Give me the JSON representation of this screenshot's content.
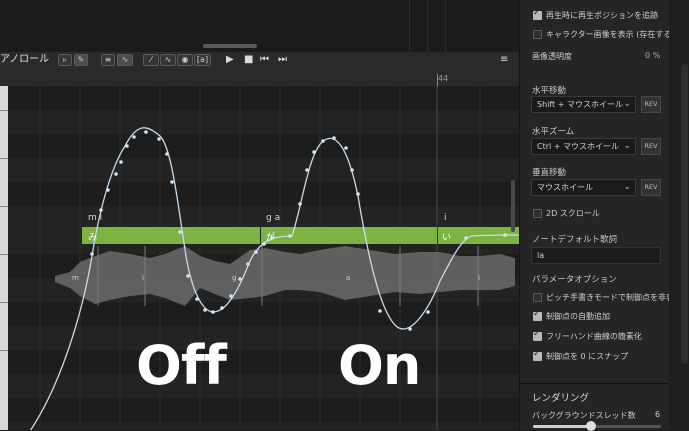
{
  "pianoroll": {
    "title": "アノロール",
    "tools": {
      "select": "▹",
      "pencil": "✎",
      "lines": "≡",
      "curve": "∿",
      "line": "⁄",
      "wave": "∿",
      "eye": "◉",
      "bracket": "[a]"
    },
    "transport": {
      "play": "▶",
      "stop": "■",
      "prev": "⏮",
      "next": "⏭"
    },
    "menu": "≡",
    "ruler_mark": "44"
  },
  "notes": [
    {
      "lyric": "み",
      "label": "m i"
    },
    {
      "lyric": "が",
      "label": "g a"
    },
    {
      "lyric": "い",
      "label": "i"
    }
  ],
  "phonemes": [
    "m",
    "i",
    "g",
    "a",
    "i"
  ],
  "overlay": {
    "left": "Off",
    "right": "On"
  },
  "panel": {
    "play_position": "再生時に再生ポジションを追跡",
    "character_image": "キャラクター画像を表示 (存在する場合)",
    "image_opacity_label": "画像透明度",
    "image_opacity_value": "0 %",
    "h_move_label": "水平移動",
    "h_move_value": "Shift + マウスホイール",
    "h_zoom_label": "水平ズーム",
    "h_zoom_value": "Ctrl + マウスホイール",
    "v_move_label": "垂直移動",
    "v_move_value": "マウスホイール",
    "rev": "REV",
    "scroll2d": "2D スクロール",
    "default_lyric_label": "ノートデフォルト歌詞",
    "default_lyric_value": "la",
    "param_options": "パラメータオプション",
    "hide_pitch_points": "ピッチ手書きモードで制御点を非表示",
    "auto_add_points": "制御点の自動追加",
    "simplify_freehand": "フリーハンド曲線の簡素化",
    "snap_zero": "制御点を 0 にスナップ",
    "rendering": "レンダリング",
    "bg_threads_label": "バックグラウンドスレッド数",
    "bg_threads_value": "6"
  },
  "colors": {
    "note": "#7cb342",
    "curve": "#c7dbea",
    "waveform": "#6e6e6e"
  }
}
